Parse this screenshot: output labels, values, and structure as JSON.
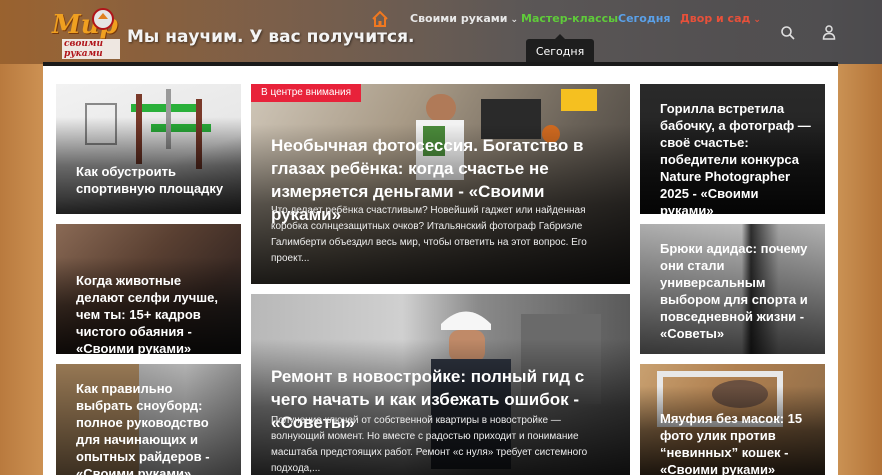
{
  "header": {
    "logo": {
      "main": "Мир",
      "sub": "своими руками"
    },
    "tagline": "Мы научим. У вас получится.",
    "nav": [
      {
        "label": "Своими руками",
        "has_dropdown": true,
        "color": "#e8e8e8"
      },
      {
        "label": "Мастер-классы",
        "has_dropdown": false,
        "color": "#5fcb3a"
      },
      {
        "label": "Сегодня",
        "has_dropdown": false,
        "color": "#5aa0e8"
      },
      {
        "label": "Двор и сад",
        "has_dropdown": true,
        "color": "#e8503a"
      }
    ],
    "tooltip": "Сегодня",
    "icons": {
      "home": "home-icon",
      "search": "search-icon",
      "user": "user-icon"
    }
  },
  "colors": {
    "accent_orange": "#f07820",
    "badge_red": "#e8223a"
  },
  "articles": {
    "left": [
      {
        "title": "Как обустроить спортивную площадку"
      },
      {
        "title": "Когда животные делают селфи лучше, чем ты: 15+ кадров чистого обаяния - «Своими руками»"
      },
      {
        "title": "Как правильно выбрать сноуборд: полное руководство для начинающих и опытных райдеров - «Своими руками»"
      }
    ],
    "center": [
      {
        "badge": "В центре внимания",
        "title": "Необычная фотосессия. Богатство в глазах ребёнка: когда счастье не измеряется деньгами - «Своими руками»",
        "excerpt": "Что делает ребёнка счастливым? Новейший гаджет или найденная коробка солнцезащитных очков? Итальянский фотограф Габриэле Галимберти объездил весь мир, чтобы ответить на этот вопрос. Его проект..."
      },
      {
        "title": "Ремонт в новостройке: полный гид с чего начать и как избежать ошибок - «Советы»",
        "excerpt": "Получение ключей от собственной квартиры в новостройке — волнующий момент. Но вместе с радостью приходит и понимание масштаба предстоящих работ. Ремонт «с нуля» требует системного подхода,..."
      }
    ],
    "right": [
      {
        "title": "Горилла встретила бабочку, а фотограф — своё счастье: победители конкурса Nature Photographer 2025 - «Своими руками»"
      },
      {
        "title": "Брюки адидас: почему они стали универсальным выбором для спорта и повседневной жизни - «Советы»"
      },
      {
        "title": "Мяуфия без масок: 15 фото улик против “невинных” кошек - «Своими руками»"
      }
    ]
  }
}
